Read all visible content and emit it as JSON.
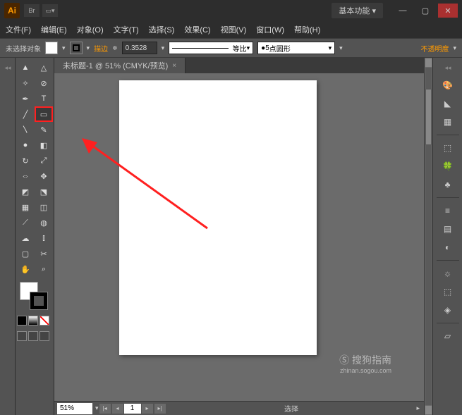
{
  "titlebar": {
    "logo": "Ai",
    "br": "Br",
    "workspace": "基本功能"
  },
  "menus": [
    "文件(F)",
    "编辑(E)",
    "对象(O)",
    "文字(T)",
    "选择(S)",
    "效果(C)",
    "视图(V)",
    "窗口(W)",
    "帮助(H)"
  ],
  "control": {
    "no_selection": "未选择对象",
    "stroke_label": "描边",
    "stroke_weight": "0.3528",
    "scale_label": "等比",
    "dot_val": "5",
    "profile_label": "点圆形",
    "opacity_label": "不透明度"
  },
  "doc": {
    "tab_title": "未标题-1 @ 51% (CMYK/预览)",
    "close": "×"
  },
  "status": {
    "zoom": "51%",
    "page": "1",
    "mode": "选择"
  },
  "tools": [
    [
      "selection",
      "direct-selection"
    ],
    [
      "magic-wand",
      "lasso"
    ],
    [
      "pen",
      "type"
    ],
    [
      "line",
      "rectangle"
    ],
    [
      "brush",
      "pencil"
    ],
    [
      "blob",
      "eraser"
    ],
    [
      "rotate",
      "scale"
    ],
    [
      "width",
      "free-transform"
    ],
    [
      "shape-builder",
      "perspective"
    ],
    [
      "mesh",
      "gradient"
    ],
    [
      "eyedropper",
      "blend"
    ],
    [
      "symbol",
      "graph"
    ],
    [
      "artboard",
      "slice"
    ],
    [
      "hand",
      "zoom"
    ]
  ],
  "tool_glyphs": {
    "selection": "▲",
    "direct-selection": "△",
    "magic-wand": "✧",
    "lasso": "⊘",
    "pen": "✒",
    "type": "T",
    "line": "╱",
    "rectangle": "▭",
    "brush": "〵",
    "pencil": "✎",
    "blob": "●",
    "eraser": "◧",
    "rotate": "↻",
    "scale": "⤢",
    "width": "⇔",
    "free-transform": "✥",
    "shape-builder": "◩",
    "perspective": "⬔",
    "mesh": "▦",
    "gradient": "◫",
    "eyedropper": "⟋",
    "blend": "◍",
    "symbol": "☁",
    "graph": "⫾",
    "artboard": "▢",
    "slice": "✂",
    "hand": "✋",
    "zoom": "⌕"
  },
  "right_icons": [
    "🎨",
    "◣",
    "▦",
    "⬚",
    "🍀",
    "♣",
    "≡",
    "▤",
    "◐",
    "☼",
    "⬚",
    "◈",
    "▱"
  ],
  "highlighted_tool": "rectangle",
  "watermark": {
    "brand": "搜狗指南",
    "url": "zhinan.sogou.com"
  }
}
